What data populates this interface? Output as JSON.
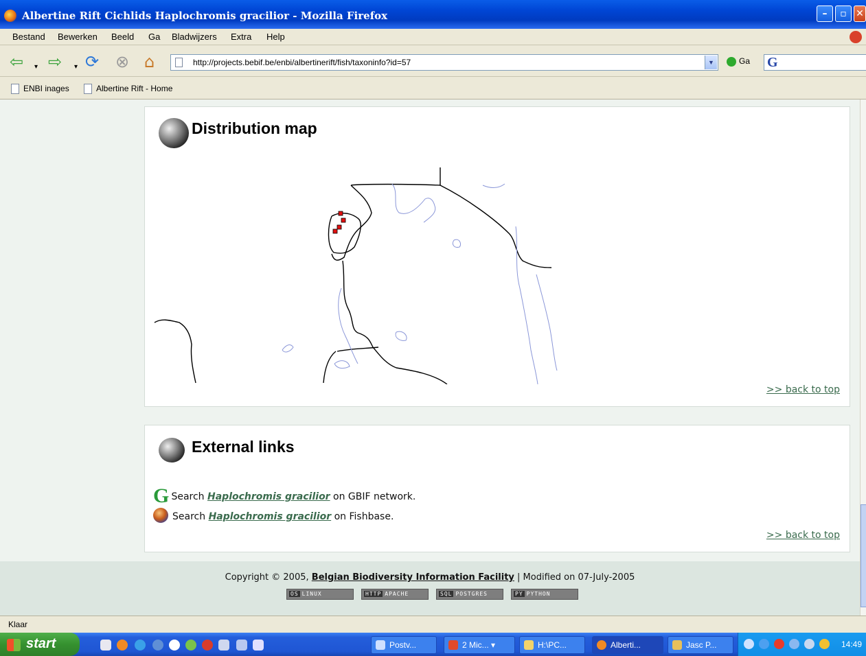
{
  "window": {
    "title": "Albertine Rift Cichlids Haplochromis gracilior - Mozilla Firefox"
  },
  "menu": {
    "items": [
      "Bestand",
      "Bewerken",
      "Beeld",
      "Ga",
      "Bladwijzers",
      "Extra",
      "Help"
    ]
  },
  "nav": {
    "url": "http://projects.bebif.be/enbi/albertinerift/fish/taxoninfo?id=57",
    "go_label": "Ga"
  },
  "bookmarks": [
    "ENBI inages",
    "Albertine Rift - Home"
  ],
  "distribution": {
    "heading": "Distribution map",
    "back_to_top": ">> back to top"
  },
  "external": {
    "heading": "External links",
    "gbif_prefix": "Search",
    "gbif_link": "Haplochromis gracilior",
    "gbif_suffix": "on GBIF network.",
    "fish_prefix": "Search",
    "fish_link": "Haplochromis gracilior",
    "fish_suffix": "on Fishbase.",
    "back_to_top": ">> back to top"
  },
  "footer": {
    "copyright_prefix": "Copyright © 2005,",
    "org_link": "Belgian Biodiversity Information Facility",
    "modified": "| Modified on 07-July-2005",
    "badges": [
      {
        "key": "OS",
        "label": "LINUX"
      },
      {
        "key": "HTTP",
        "label": "APACHE"
      },
      {
        "key": "SQL",
        "label": "POSTGRES"
      },
      {
        "key": "PY",
        "label": "PYTHON"
      }
    ]
  },
  "status": {
    "text": "Klaar"
  },
  "taskbar": {
    "start": "start",
    "tasks": [
      "Postv...",
      "2 Mic...",
      "H:\\PC...",
      "Alberti...",
      "Jasc P..."
    ],
    "clock": "14:49"
  },
  "colors": {
    "titlebar": "#0046d5",
    "content_bg": "#eef3ef",
    "link": "#3a6b4d",
    "footer_bg": "#dce6e0"
  }
}
